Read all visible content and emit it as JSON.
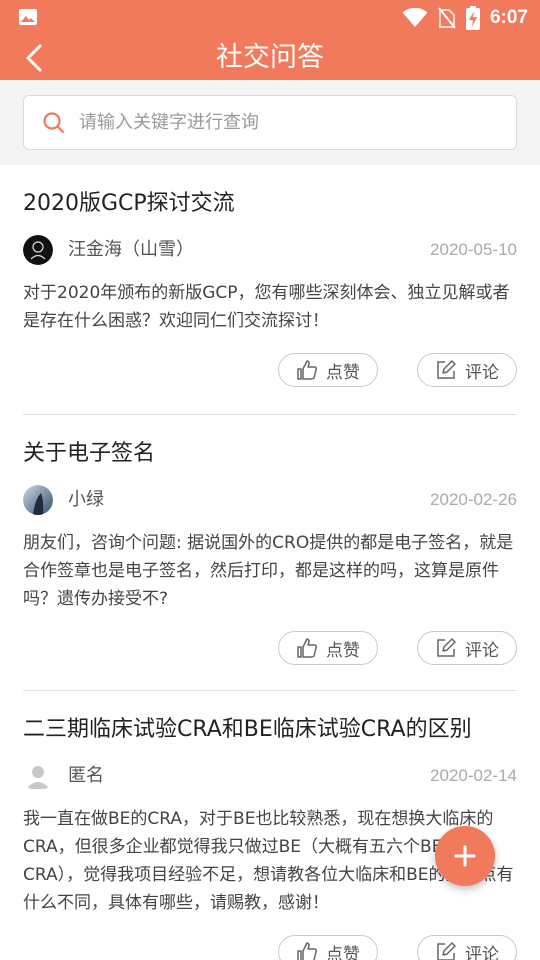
{
  "app": {
    "title": "社交问答",
    "accent": "#f17a5c"
  },
  "status_bar": {
    "time": "6:07",
    "icons": [
      "image-icon",
      "wifi-icon",
      "no-sim-icon",
      "battery-charging-icon"
    ]
  },
  "search": {
    "placeholder": "请输入关键字进行查询",
    "value": ""
  },
  "posts": [
    {
      "title": "2020版GCP探讨交流",
      "author": "汪金海（山雪）",
      "date": "2020-05-10",
      "body": "对于2020年颁布的新版GCP，您有哪些深刻体会、独立见解或者是存在什么困惑？欢迎同仁们交流探讨！",
      "like_label": "点赞",
      "comment_label": "评论",
      "avatar": "dark-avatar"
    },
    {
      "title": "关于电子签名",
      "author": "小绿",
      "date": "2020-02-26",
      "body": "朋友们，咨询个问题: 据说国外的CRO提供的都是电子签名，就是合作签章也是电子签名，然后打印，都是这样的吗，这算是原件吗？遗传办接受不?",
      "like_label": "点赞",
      "comment_label": "评论",
      "avatar": "photo-avatar"
    },
    {
      "title": "二三期临床试验CRA和BE临床试验CRA的区别",
      "author": "匿名",
      "date": "2020-02-14",
      "body": "我一直在做BE的CRA，对于BE也比较熟悉，现在想换大临床的CRA，但很多企业都觉得我只做过BE（大概有五六个BE,一年CRA），觉得我项目经验不足，想请教各位大临床和BE的查重点有什么不同，具体有哪些，请赐教，感谢！",
      "like_label": "点赞",
      "comment_label": "评论",
      "avatar": "default-user-avatar"
    }
  ],
  "fab": {
    "icon": "plus-icon"
  }
}
